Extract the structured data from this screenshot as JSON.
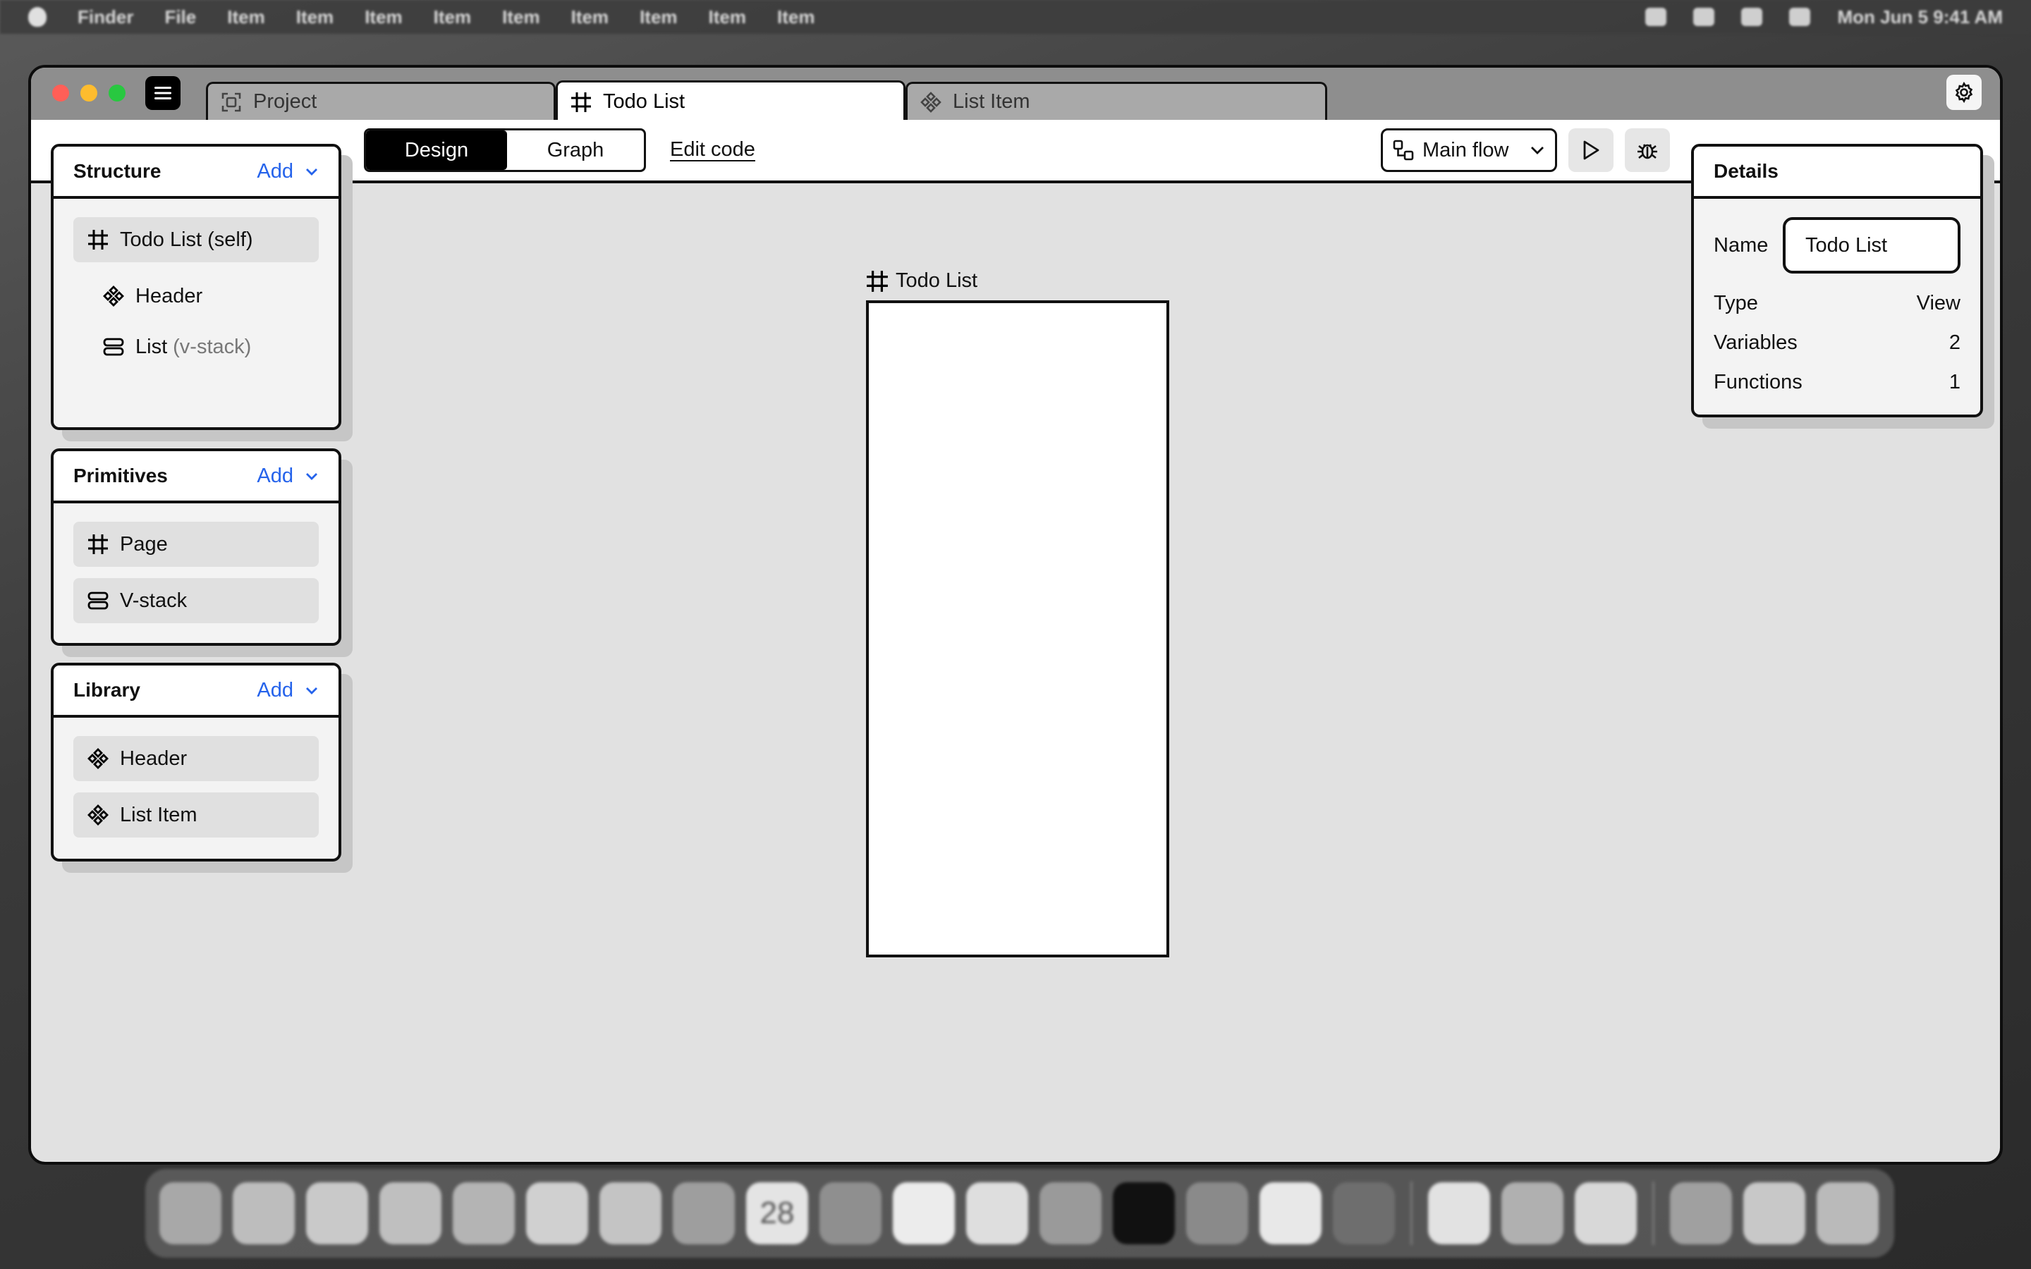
{
  "menubar": {
    "app_name": "Finder",
    "items": [
      "File",
      "Item",
      "Item",
      "Item",
      "Item",
      "Item",
      "Item",
      "Item",
      "Item",
      "Item"
    ],
    "clock": "Mon Jun 5  9:41 AM"
  },
  "window": {
    "tabs": [
      {
        "label": "Project",
        "icon": "frame-select-icon",
        "active": false
      },
      {
        "label": "Todo List",
        "icon": "hash-frame-icon",
        "active": true
      },
      {
        "label": "List Item",
        "icon": "component-icon",
        "active": false
      }
    ]
  },
  "toolbar": {
    "mode_design": "Design",
    "mode_graph": "Graph",
    "active_mode": "Design",
    "edit_code": "Edit code",
    "flow_selector": "Main flow"
  },
  "structure": {
    "title": "Structure",
    "add_label": "Add",
    "items": [
      {
        "label": "Todo List (self)",
        "icon": "hash-frame-icon"
      },
      {
        "label": "Header",
        "icon": "component-icon"
      },
      {
        "label": "List",
        "detail": "(v-stack)",
        "icon": "vstack-icon"
      }
    ]
  },
  "primitives": {
    "title": "Primitives",
    "add_label": "Add",
    "items": [
      {
        "label": "Page",
        "icon": "hash-frame-icon"
      },
      {
        "label": "V-stack",
        "icon": "vstack-icon"
      }
    ]
  },
  "library": {
    "title": "Library",
    "add_label": "Add",
    "items": [
      {
        "label": "Header",
        "icon": "component-icon"
      },
      {
        "label": "List Item",
        "icon": "component-icon"
      }
    ]
  },
  "canvas": {
    "frame_label": "Todo List"
  },
  "details": {
    "title": "Details",
    "name_label": "Name",
    "name_value": "Todo List",
    "type_label": "Type",
    "type_value": "View",
    "variables_label": "Variables",
    "variables_value": "2",
    "functions_label": "Functions",
    "functions_value": "1"
  },
  "dock": {
    "calendar_day": "28"
  }
}
